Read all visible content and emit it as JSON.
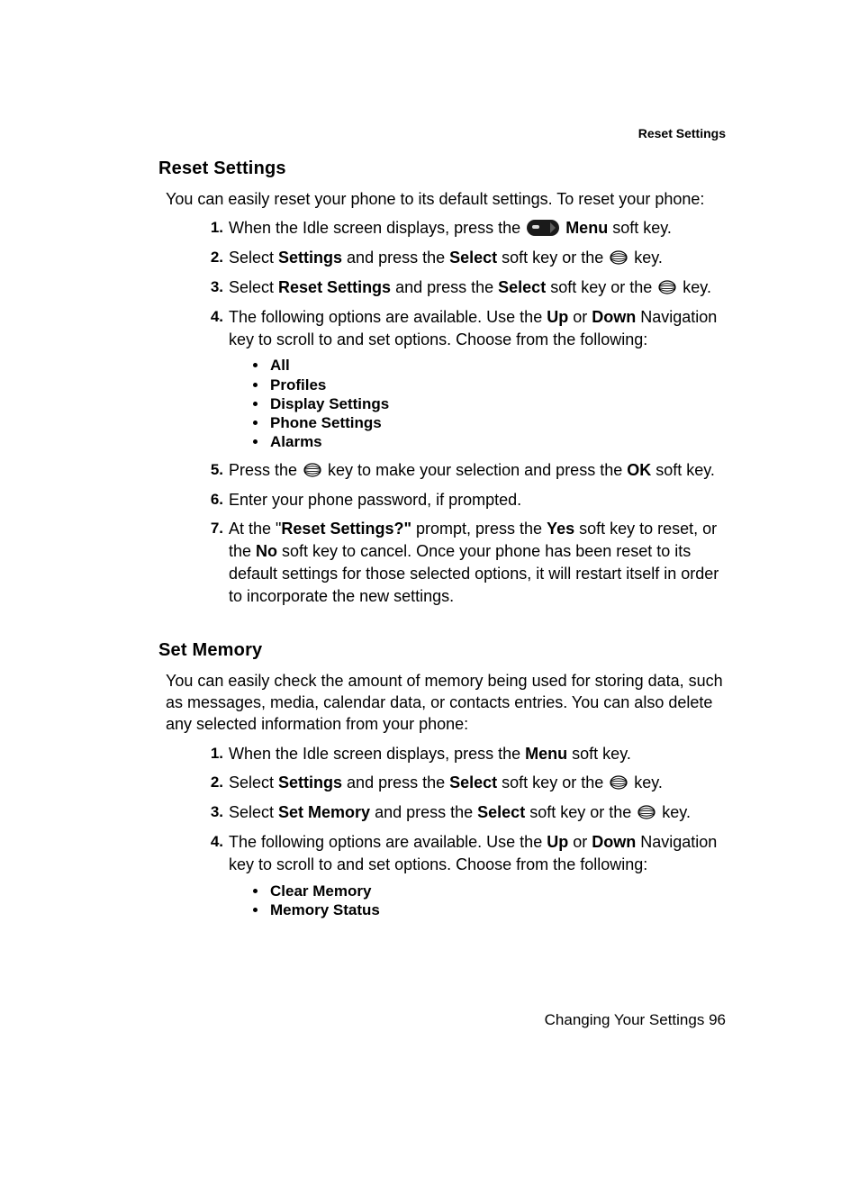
{
  "runningHeader": "Reset Settings",
  "footer": {
    "section": "Changing Your Settings",
    "page": "96"
  },
  "reset": {
    "heading": "Reset Settings",
    "intro": "You can easily reset your phone to its default settings. To reset your phone:",
    "steps": {
      "s1": {
        "num": "1.",
        "t1": "When the Idle screen displays, press the ",
        "b1": "Menu",
        "t2": " soft key."
      },
      "s2": {
        "num": "2.",
        "t1": "Select ",
        "b1": "Settings",
        "t2": " and press the ",
        "b2": "Select",
        "t3": " soft key or the ",
        "t4": " key."
      },
      "s3": {
        "num": "3.",
        "t1": "Select ",
        "b1": "Reset Settings",
        "t2": " and press the ",
        "b2": "Select",
        "t3": " soft key or the ",
        "t4": " key."
      },
      "s4": {
        "num": "4.",
        "t1": "The following options are available. Use the ",
        "b1": "Up",
        "t2": " or ",
        "b2": "Down",
        "t3": " Navigation key to scroll to and set options. Choose from the following:",
        "opts": {
          "o1": "All",
          "o2": "Profiles",
          "o3": "Display Settings",
          "o4": "Phone Settings",
          "o5": "Alarms"
        }
      },
      "s5": {
        "num": "5.",
        "t1": "Press the ",
        "t2": " key to make your selection and press the ",
        "b1": "OK",
        "t3": " soft key."
      },
      "s6": {
        "num": "6.",
        "t1": "Enter your phone password, if prompted."
      },
      "s7": {
        "num": "7.",
        "t1": "At the \"",
        "b1": "Reset Settings?\"",
        "t2": " prompt, press the ",
        "b2": "Yes",
        "t3": " soft key to reset, or the ",
        "b3": "No",
        "t4": " soft key to cancel. Once your phone has been reset to its default settings for those selected options, it will restart itself in order to incorporate the new settings."
      }
    }
  },
  "memory": {
    "heading": "Set Memory",
    "intro": "You can easily check the amount of memory being used for storing data, such as messages, media, calendar data, or contacts entries. You can also delete any selected information from your phone:",
    "steps": {
      "s1": {
        "num": "1.",
        "t1": "When the Idle screen displays, press the ",
        "b1": "Menu",
        "t2": " soft key."
      },
      "s2": {
        "num": "2.",
        "t1": "Select ",
        "b1": "Settings",
        "t2": " and press the ",
        "b2": "Select",
        "t3": " soft key or the ",
        "t4": " key."
      },
      "s3": {
        "num": "3.",
        "t1": "Select ",
        "b1": "Set Memory",
        "t2": " and press the ",
        "b2": "Select",
        "t3": " soft key or the ",
        "t4": " key."
      },
      "s4": {
        "num": "4.",
        "t1": "The following options are available. Use the ",
        "b1": "Up",
        "t2": " or ",
        "b2": "Down",
        "t3": " Navigation key to scroll to and set options. Choose from the following:",
        "opts": {
          "o1": "Clear Memory",
          "o2": "Memory Status"
        }
      }
    }
  }
}
